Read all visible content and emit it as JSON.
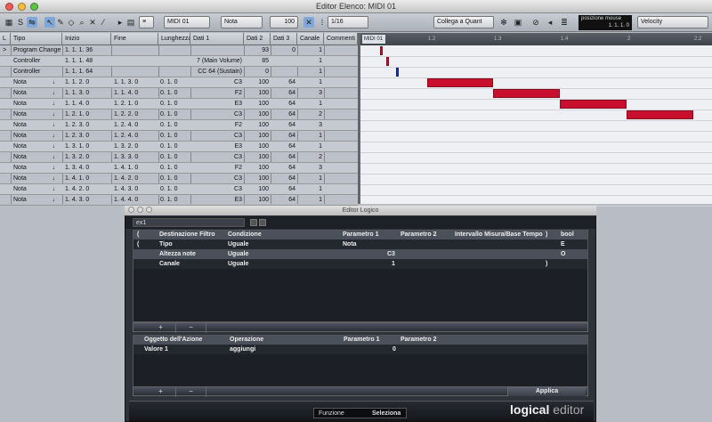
{
  "window": {
    "title": "Editor Elenco: MIDI 01"
  },
  "toolbar": {
    "track": "MIDI 01",
    "filter": "Nota",
    "value_in": "100",
    "quantize": "1/16",
    "link": "Collega a Quant",
    "pos_label": "posizione mouse",
    "pos_value": "1. 1. 1. 0",
    "lane": "Velocity"
  },
  "list": {
    "columns": [
      "L",
      "Tipo",
      "Inizio",
      "Fine",
      "Lunghezza",
      "Dati 1",
      "Dati 2",
      "Dati 3",
      "Canale",
      "Commenti"
    ],
    "rows": [
      {
        "mark": ">",
        "type": "Program Change",
        "start": "1. 1. 1. 36",
        "end": "",
        "len": "",
        "d1": "",
        "d2": "93",
        "d3": "0",
        "ch": "1"
      },
      {
        "mark": "",
        "type": "Controller",
        "start": "1. 1. 1. 48",
        "end": "",
        "len": "",
        "d1": "7 (Main Volume)",
        "d2": "85",
        "d3": "",
        "ch": "1"
      },
      {
        "mark": "",
        "type": "Controller",
        "start": "1. 1. 1. 64",
        "end": "",
        "len": "",
        "d1": "CC 64 (Sustain)",
        "d2": "0",
        "d3": "",
        "ch": "1"
      },
      {
        "mark": "",
        "type": "Nota",
        "start": "1. 1. 2. 0",
        "end": "1. 1. 3. 0",
        "len": "0. 1. 0",
        "d1": "C3",
        "d2": "100",
        "d3": "64",
        "ch": "1"
      },
      {
        "mark": "",
        "type": "Nota",
        "start": "1. 1. 3. 0",
        "end": "1. 1. 4. 0",
        "len": "0. 1. 0",
        "d1": "F2",
        "d2": "100",
        "d3": "64",
        "ch": "3"
      },
      {
        "mark": "",
        "type": "Nota",
        "start": "1. 1. 4. 0",
        "end": "1. 2. 1. 0",
        "len": "0. 1. 0",
        "d1": "E3",
        "d2": "100",
        "d3": "64",
        "ch": "1"
      },
      {
        "mark": "",
        "type": "Nota",
        "start": "1. 2. 1. 0",
        "end": "1. 2. 2. 0",
        "len": "0. 1. 0",
        "d1": "C3",
        "d2": "100",
        "d3": "64",
        "ch": "2"
      },
      {
        "mark": "",
        "type": "Nota",
        "start": "1. 2. 3. 0",
        "end": "1. 2. 4. 0",
        "len": "0. 1. 0",
        "d1": "F2",
        "d2": "100",
        "d3": "64",
        "ch": "3"
      },
      {
        "mark": "",
        "type": "Nota",
        "start": "1. 2. 3. 0",
        "end": "1. 2. 4. 0",
        "len": "0. 1. 0",
        "d1": "C3",
        "d2": "100",
        "d3": "64",
        "ch": "1"
      },
      {
        "mark": "",
        "type": "Nota",
        "start": "1. 3. 1. 0",
        "end": "1. 3. 2. 0",
        "len": "0. 1. 0",
        "d1": "E3",
        "d2": "100",
        "d3": "64",
        "ch": "1"
      },
      {
        "mark": "",
        "type": "Nota",
        "start": "1. 3. 2. 0",
        "end": "1. 3. 3. 0",
        "len": "0. 1. 0",
        "d1": "C3",
        "d2": "100",
        "d3": "64",
        "ch": "2"
      },
      {
        "mark": "",
        "type": "Nota",
        "start": "1. 3. 4. 0",
        "end": "1. 4. 1. 0",
        "len": "0. 1. 0",
        "d1": "F2",
        "d2": "100",
        "d3": "64",
        "ch": "3"
      },
      {
        "mark": "",
        "type": "Nota",
        "start": "1. 4. 1. 0",
        "end": "1. 4. 2. 0",
        "len": "0. 1. 0",
        "d1": "C3",
        "d2": "100",
        "d3": "64",
        "ch": "1"
      },
      {
        "mark": "",
        "type": "Nota",
        "start": "1. 4. 2. 0",
        "end": "1. 4. 3. 0",
        "len": "0. 1. 0",
        "d1": "C3",
        "d2": "100",
        "d3": "64",
        "ch": "1"
      },
      {
        "mark": "",
        "type": "Nota",
        "start": "1. 4. 3. 0",
        "end": "1. 4. 4. 0",
        "len": "0. 1. 0",
        "d1": "E3",
        "d2": "100",
        "d3": "64",
        "ch": "1"
      }
    ]
  },
  "ruler": {
    "part": "MIDI 01",
    "ticks": [
      "1.2",
      "1.3",
      "1.4",
      "2",
      "2.2"
    ]
  },
  "logic": {
    "title": "Editor Logico",
    "preset": "ex1",
    "filter_cols": [
      "(",
      "Destinazione Filtro",
      "Condizione",
      "Parametro 1",
      "Parametro 2",
      "Intervallo Misura/Base Tempo",
      ")",
      "bool"
    ],
    "filter_rows": [
      {
        "open": "(",
        "target": "Tipo",
        "cond": "Uguale",
        "p1": "Nota",
        "p2": "",
        "close": "",
        "bool": "E"
      },
      {
        "open": "",
        "target": "Altezza note",
        "cond": "Uguale",
        "p1": "C3",
        "p2": "",
        "close": "",
        "bool": "O"
      },
      {
        "open": "",
        "target": "Canale",
        "cond": "Uguale",
        "p1": "1",
        "p2": "",
        "close": ")",
        "bool": ""
      }
    ],
    "action_cols": [
      "Oggetto dell'Azione",
      "Operazione",
      "Parametro 1",
      "Parametro 2"
    ],
    "action_rows": [
      {
        "target": "Valore 1",
        "op": "aggiungi",
        "p1": "0",
        "p2": ""
      }
    ],
    "add": "+",
    "remove": "−",
    "apply": "Applica",
    "function_label": "Funzione",
    "function_value": "Seleziona",
    "brand_bold": "logical",
    "brand_light": " editor"
  }
}
